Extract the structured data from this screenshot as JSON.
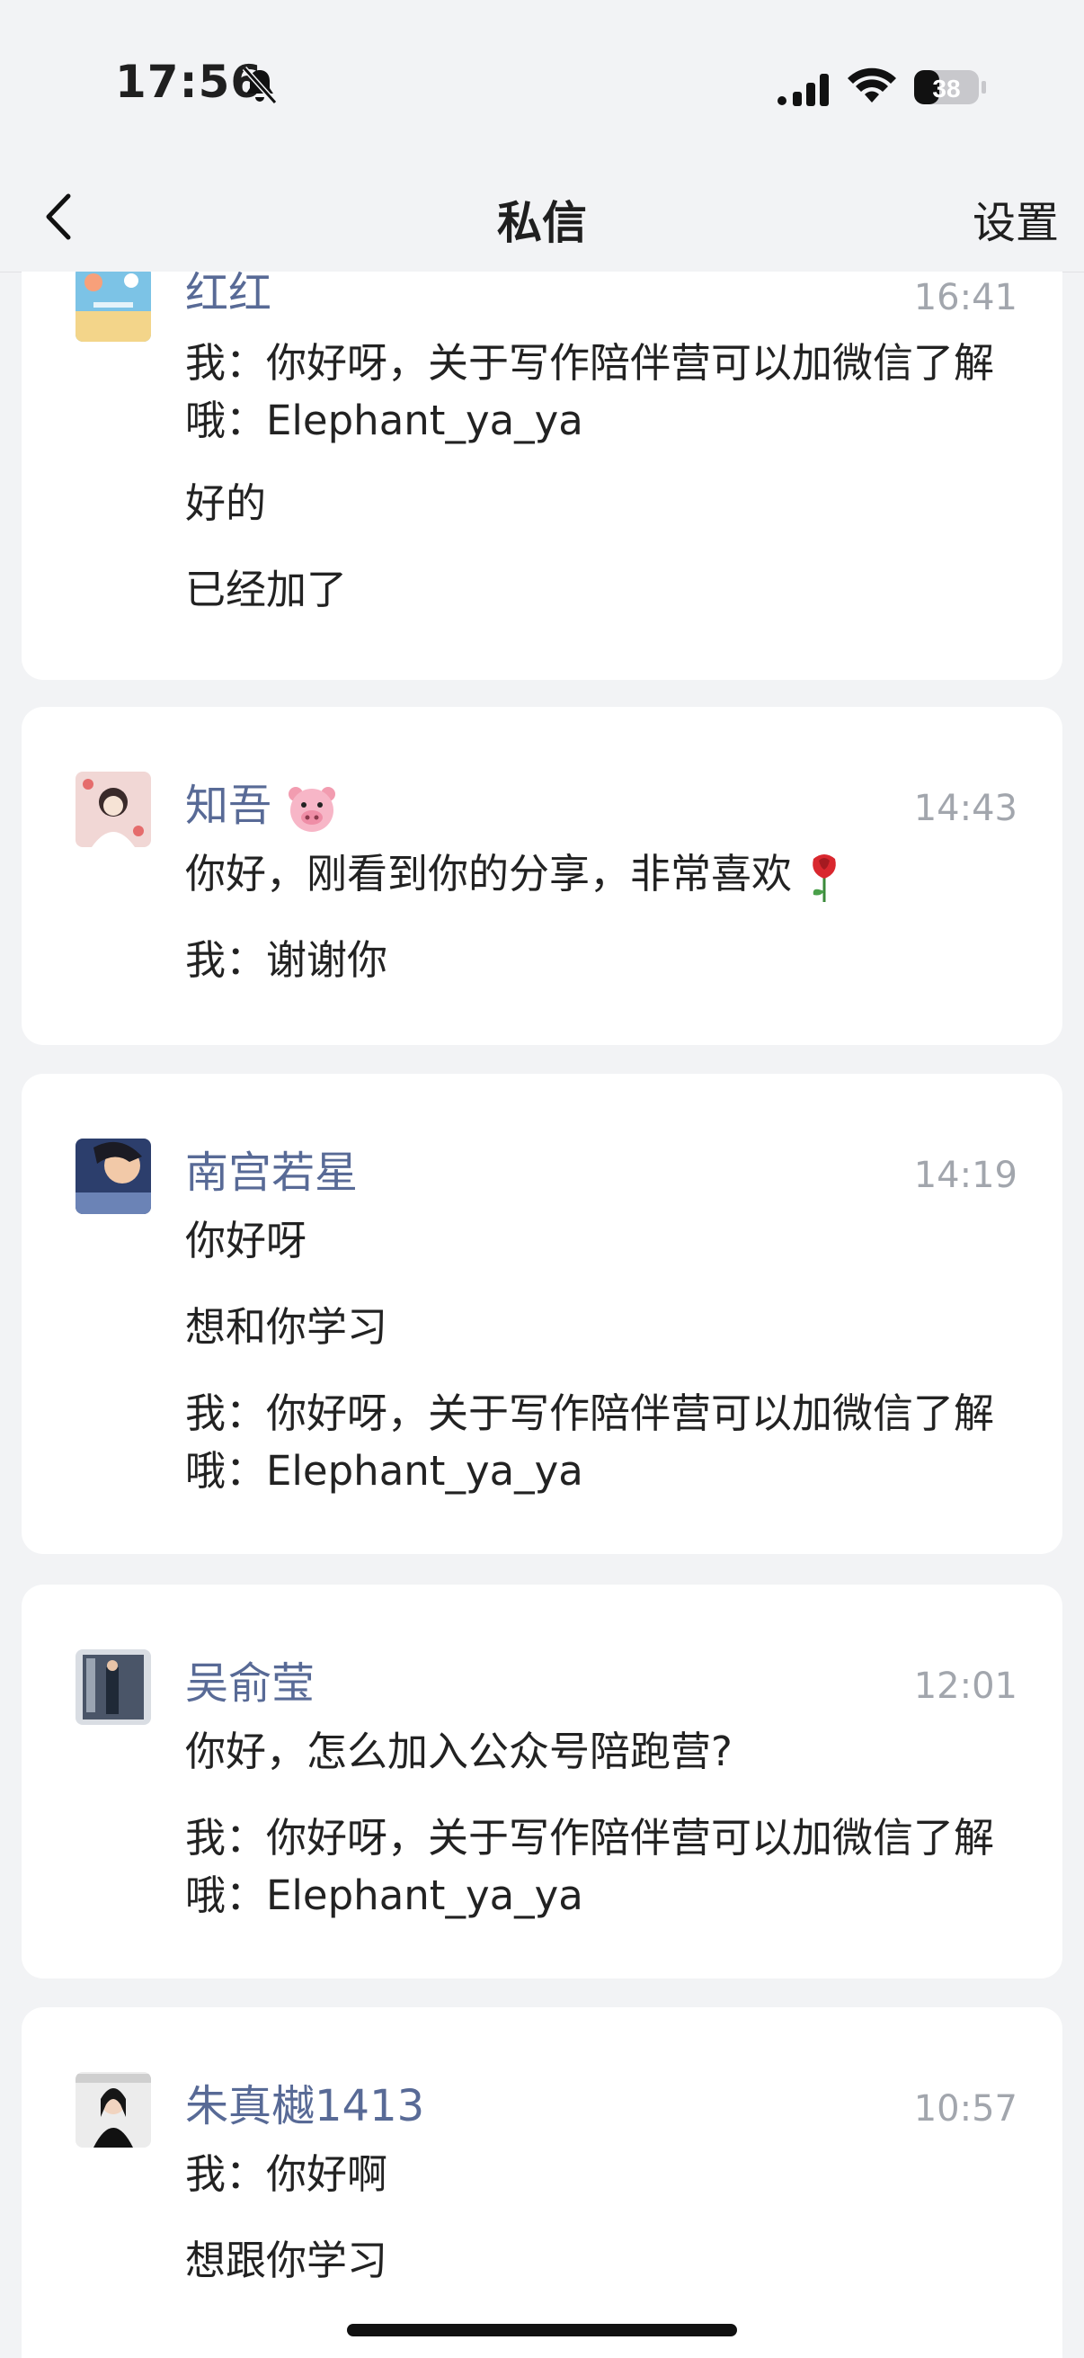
{
  "status_bar": {
    "time": "17:56",
    "battery_level": "38"
  },
  "nav": {
    "title": "私信",
    "settings_label": "设置"
  },
  "conversations": [
    {
      "name": "红红",
      "time": "16:41",
      "messages": [
        "我：你好呀，关于写作陪伴营可以加微信了解哦：Elephant_ya_ya",
        "好的",
        "已经加了"
      ]
    },
    {
      "name": "知吾",
      "time": "14:43",
      "messages": [
        "你好，刚看到你的分享，非常喜欢",
        "我：谢谢你"
      ]
    },
    {
      "name": "南宫若星",
      "time": "14:19",
      "messages": [
        "你好呀",
        "想和你学习",
        "我：你好呀，关于写作陪伴营可以加微信了解哦：Elephant_ya_ya"
      ]
    },
    {
      "name": "吴俞莹",
      "time": "12:01",
      "messages": [
        "你好，怎么加入公众号陪跑营?",
        "我：你好呀，关于写作陪伴营可以加微信了解哦：Elephant_ya_ya"
      ]
    },
    {
      "name": "朱真樾1413",
      "time": "10:57",
      "messages": [
        "我：你好啊",
        "想跟你学习"
      ]
    }
  ],
  "colors": {
    "background": "#f2f3f5",
    "name_blue": "#586a96",
    "timestamp_gray": "#a2a6ad"
  }
}
